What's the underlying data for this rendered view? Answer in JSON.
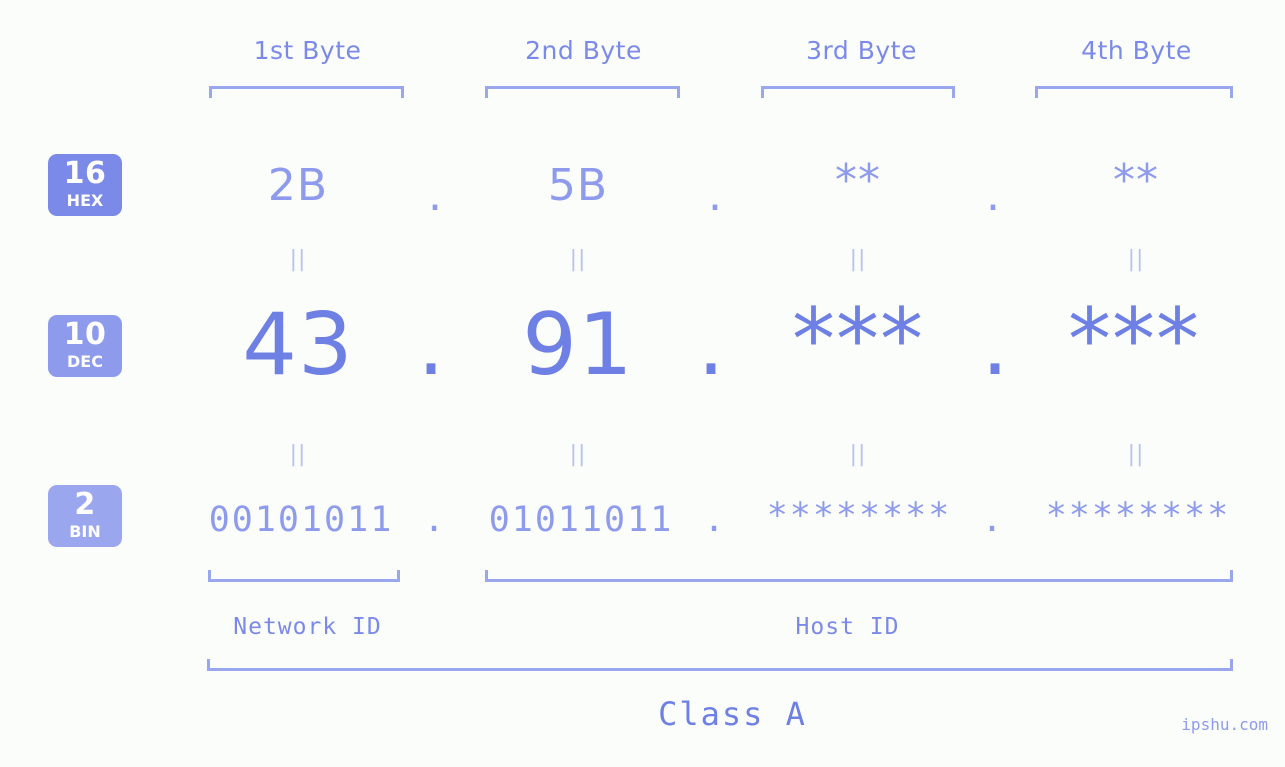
{
  "byte_headers": [
    {
      "label": "1st Byte"
    },
    {
      "label": "2nd Byte"
    },
    {
      "label": "3rd Byte"
    },
    {
      "label": "4th Byte"
    }
  ],
  "rows": {
    "hex": {
      "badge_number": "16",
      "badge_name": "HEX",
      "values": [
        "2B",
        "5B",
        "**",
        "**"
      ],
      "separator": "."
    },
    "dec": {
      "badge_number": "10",
      "badge_name": "DEC",
      "values": [
        "43",
        "91",
        "***",
        "***"
      ],
      "separator": "."
    },
    "bin": {
      "badge_number": "2",
      "badge_name": "BIN",
      "values": [
        "00101011",
        "01011011",
        "********",
        "********"
      ],
      "separator": "."
    }
  },
  "connectors": {
    "symbol": "||",
    "count_per_gap": 4
  },
  "segments": {
    "network_id": "Network ID",
    "host_id": "Host ID",
    "class": "Class A"
  },
  "watermark": "ipshu.com",
  "colors": {
    "background": "#fbfdfb",
    "accent": "#7b8ae8",
    "accent_light": "#9aa7ee",
    "accent_dark": "#6f80e4",
    "connector": "#b9c2f2"
  }
}
